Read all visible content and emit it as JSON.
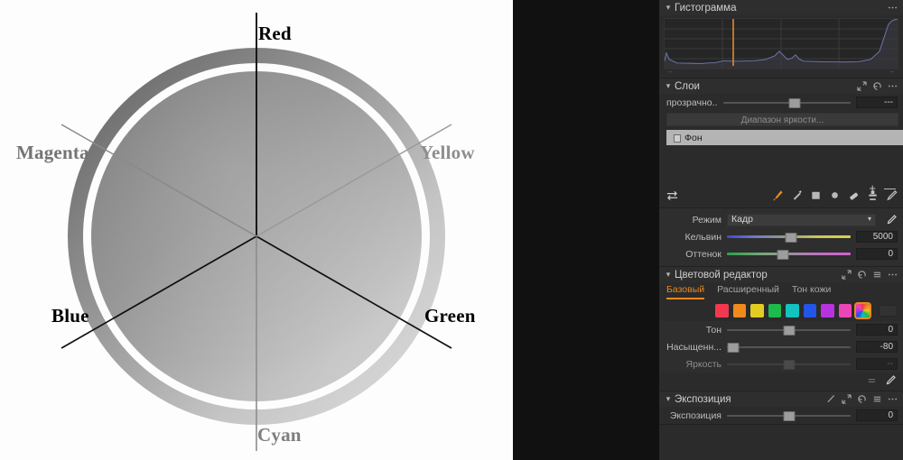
{
  "figure": {
    "name": "color-wheel-diagram",
    "labels": [
      {
        "text": "Red",
        "color": "#000000"
      },
      {
        "text": "Yellow",
        "color": "#8e8e8e"
      },
      {
        "text": "Green",
        "color": "#000000"
      },
      {
        "text": "Cyan",
        "color": "#7e7e7e"
      },
      {
        "text": "Blue",
        "color": "#000000"
      },
      {
        "text": "Magenta",
        "color": "#747474"
      }
    ]
  },
  "panel": {
    "histogram": {
      "title": "Гистограмма",
      "menu_icon": "ellipsis-icon",
      "axis_left": "--",
      "axis_right": "--",
      "curve_color": "#7b86c7",
      "marker_color": "#e08a2c"
    },
    "layers": {
      "title": "Слои",
      "icons": [
        "expand-icon",
        "reset-icon",
        "ellipsis-icon"
      ],
      "opacity_label": "прозрачно...",
      "opacity_value": "---",
      "luminosity_button": "Диапазон яркости...",
      "items": [
        {
          "name": "Фон"
        }
      ]
    },
    "toolbar": {
      "swap_icon": "swap-arrows-icon",
      "add_label": "+",
      "remove_label": "—",
      "tools": [
        "brush-icon",
        "wand-icon",
        "gradient-linear-icon",
        "gradient-radial-icon",
        "eraser-icon",
        "clone-stamp-icon",
        "pen-icon"
      ]
    },
    "white_balance": {
      "mode_label": "Режим",
      "mode_value": "Кадр",
      "picker_icon": "eyedropper-icon",
      "kelvin_label": "Кельвин",
      "kelvin_value": "5000",
      "tint_label": "Оттенок",
      "tint_value": "0"
    },
    "color_editor": {
      "title": "Цветовой редактор",
      "icons": [
        "expand-icon",
        "reset-icon",
        "list-icon",
        "ellipsis-icon"
      ],
      "tabs": [
        {
          "label": "Базовый",
          "active": true
        },
        {
          "label": "Расширенный",
          "active": false
        },
        {
          "label": "Тон кожи",
          "active": false
        }
      ],
      "swatches": [
        {
          "name": "red",
          "color": "#f2384f"
        },
        {
          "name": "orange",
          "color": "#f08a1c"
        },
        {
          "name": "yellow",
          "color": "#e3cb22"
        },
        {
          "name": "green",
          "color": "#1dbb4b"
        },
        {
          "name": "cyan",
          "color": "#12c3c0"
        },
        {
          "name": "blue",
          "color": "#2355e8"
        },
        {
          "name": "purple",
          "color": "#b833e0"
        },
        {
          "name": "magenta",
          "color": "#ec45b8"
        },
        {
          "name": "all",
          "color": "rainbow",
          "selected": true
        }
      ],
      "sliders": [
        {
          "label": "Тон",
          "value": "0",
          "pos": 50,
          "disabled": false
        },
        {
          "label": "Насыщенн...",
          "value": "-80",
          "pos": 4,
          "disabled": false
        },
        {
          "label": "Яркость",
          "value": "--",
          "pos": 50,
          "disabled": true
        }
      ],
      "foot_icons": [
        "reset-icon",
        "eyedropper-icon"
      ]
    },
    "exposure": {
      "title": "Экспозиция",
      "icons": [
        "pen-icon",
        "expand-icon",
        "reset-icon",
        "list-icon",
        "ellipsis-icon"
      ],
      "slider_label": "Экспозиция",
      "slider_value": "0"
    }
  }
}
